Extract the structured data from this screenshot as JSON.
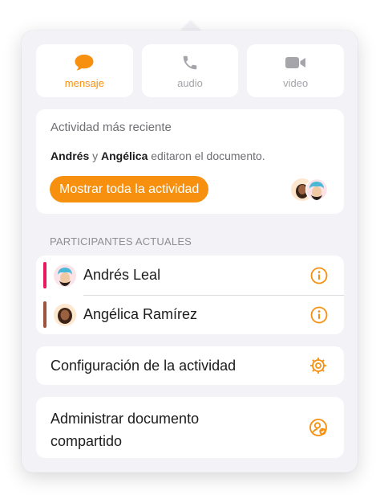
{
  "accent_color": "#f7900f",
  "communication": [
    {
      "label": "mensaje",
      "icon": "message-bubble-icon",
      "active": true
    },
    {
      "label": "audio",
      "icon": "phone-icon",
      "active": false
    },
    {
      "label": "video",
      "icon": "video-camera-icon",
      "active": false
    }
  ],
  "recent_activity": {
    "title": "Actividad más reciente",
    "user1": "Andrés",
    "conjunction": "y",
    "user2": "Angélica",
    "action": "editaron el documento.",
    "button_label": "Mostrar toda la actividad"
  },
  "participants_section": {
    "label": "PARTICIPANTES ACTUALES",
    "items": [
      {
        "name": "Andrés Leal",
        "color": "#e8195d"
      },
      {
        "name": "Angélica Ramírez",
        "color": "#a0523a"
      }
    ]
  },
  "activity_settings": {
    "label": "Configuración de la actividad"
  },
  "manage_shared": {
    "label": "Administrar documento compartido"
  }
}
